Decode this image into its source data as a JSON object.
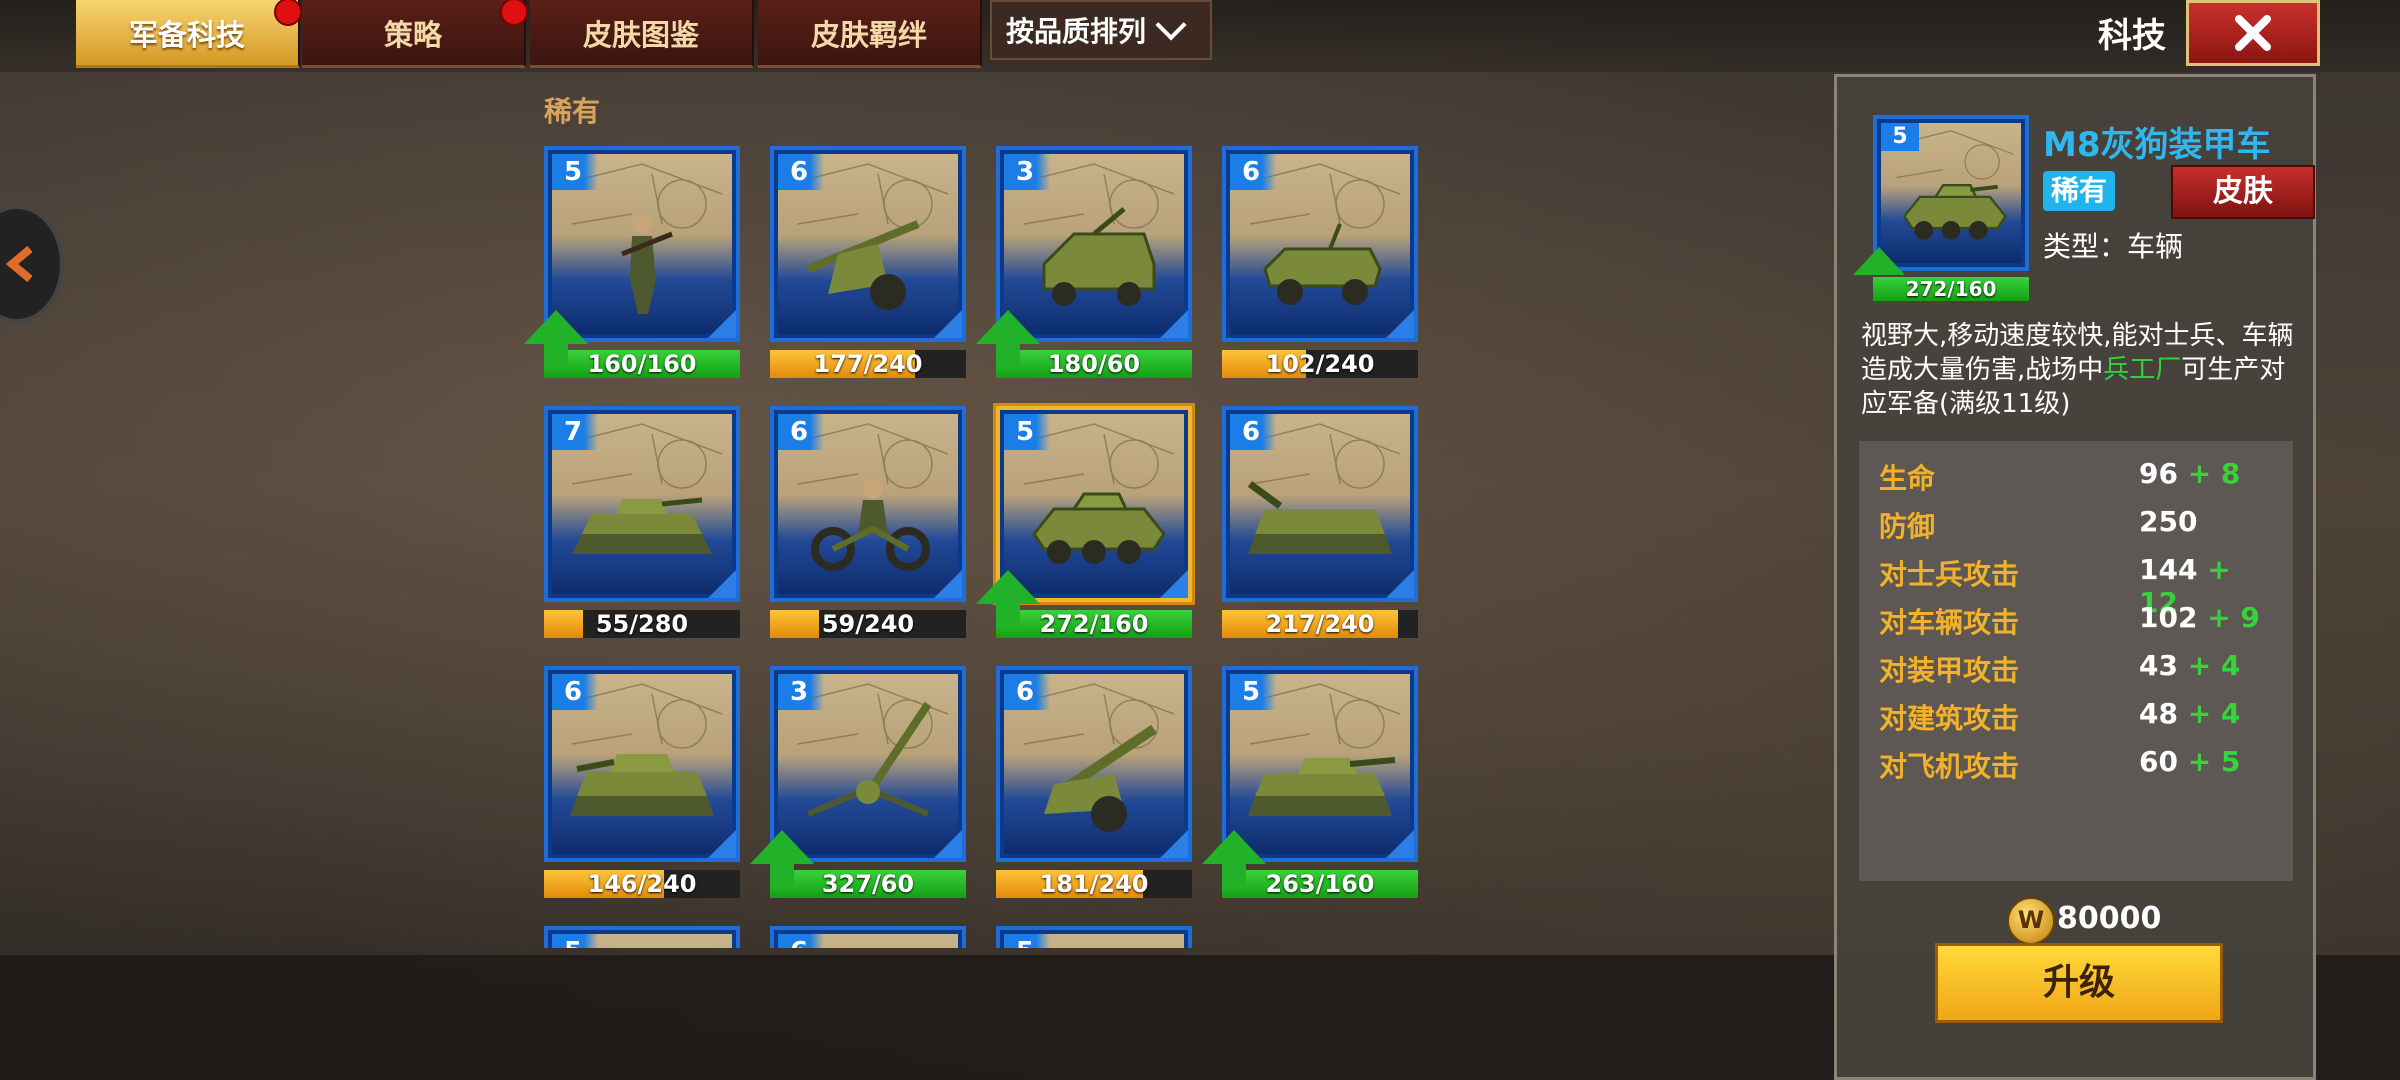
{
  "tabs": [
    {
      "label": "军备科技",
      "active": true,
      "dot": true
    },
    {
      "label": "策略",
      "active": false,
      "dot": true
    },
    {
      "label": "皮肤图鉴",
      "active": false,
      "dot": false
    },
    {
      "label": "皮肤羁绊",
      "active": false,
      "dot": false
    }
  ],
  "sort": {
    "label": "按品质排列",
    "icon": "chevron-down-icon"
  },
  "header": {
    "title": "科技",
    "close_icon": "close-icon"
  },
  "section_label": "稀有",
  "cards": [
    {
      "level": "5",
      "progress": "160/160",
      "fill": 1.0,
      "color": "green",
      "upgrade": true,
      "unit": "soldier"
    },
    {
      "level": "6",
      "progress": "177/240",
      "fill": 0.74,
      "color": "orange",
      "upgrade": false,
      "unit": "anti-tank-gun"
    },
    {
      "level": "3",
      "progress": "180/60",
      "fill": 1.0,
      "color": "green",
      "upgrade": true,
      "unit": "truck"
    },
    {
      "level": "6",
      "progress": "102/240",
      "fill": 0.43,
      "color": "orange",
      "upgrade": false,
      "unit": "jeep"
    },
    {
      "level": "7",
      "progress": "55/280",
      "fill": 0.2,
      "color": "orange",
      "upgrade": false,
      "unit": "light-tank"
    },
    {
      "level": "6",
      "progress": "59/240",
      "fill": 0.25,
      "color": "orange",
      "upgrade": false,
      "unit": "motorcycle"
    },
    {
      "level": "5",
      "progress": "272/160",
      "fill": 1.0,
      "color": "green",
      "upgrade": true,
      "unit": "armored-car",
      "selected": true
    },
    {
      "level": "6",
      "progress": "217/240",
      "fill": 0.9,
      "color": "orange",
      "upgrade": false,
      "unit": "spg"
    },
    {
      "level": "6",
      "progress": "146/240",
      "fill": 0.61,
      "color": "orange",
      "upgrade": false,
      "unit": "medium-tank"
    },
    {
      "level": "3",
      "progress": "327/60",
      "fill": 1.0,
      "color": "green",
      "upgrade": true,
      "unit": "aa-gun"
    },
    {
      "level": "6",
      "progress": "181/240",
      "fill": 0.75,
      "color": "orange",
      "upgrade": false,
      "unit": "howitzer"
    },
    {
      "level": "5",
      "progress": "263/160",
      "fill": 1.0,
      "color": "green",
      "upgrade": true,
      "unit": "tank-destroyer"
    }
  ],
  "partial_row_levels": [
    "5",
    "6",
    "5"
  ],
  "detail": {
    "level": "5",
    "progress": "272/160",
    "name": "M8灰狗装甲车",
    "rarity": "稀有",
    "skin_button": "皮肤",
    "type": "类型：车辆",
    "desc_part1": "视野大,移动速度较快,能对士兵、车辆造成大量伤害,战场中",
    "desc_highlight": "兵工厂",
    "desc_part2": "可生产对应军备(满级11级)",
    "stats": [
      {
        "name": "生命",
        "value": "96",
        "bonus": "+ 8"
      },
      {
        "name": "防御",
        "value": "250",
        "bonus": ""
      },
      {
        "name": "对士兵攻击",
        "value": "144",
        "bonus": "+ 12"
      },
      {
        "name": "对车辆攻击",
        "value": "102",
        "bonus": "+ 9"
      },
      {
        "name": "对装甲攻击",
        "value": "43",
        "bonus": "+ 4"
      },
      {
        "name": "对建筑攻击",
        "value": "48",
        "bonus": "+ 4"
      },
      {
        "name": "对飞机攻击",
        "value": "60",
        "bonus": "+ 5"
      }
    ],
    "coin_icon_label": "W",
    "cost": "80000",
    "upgrade_button": "升级"
  }
}
